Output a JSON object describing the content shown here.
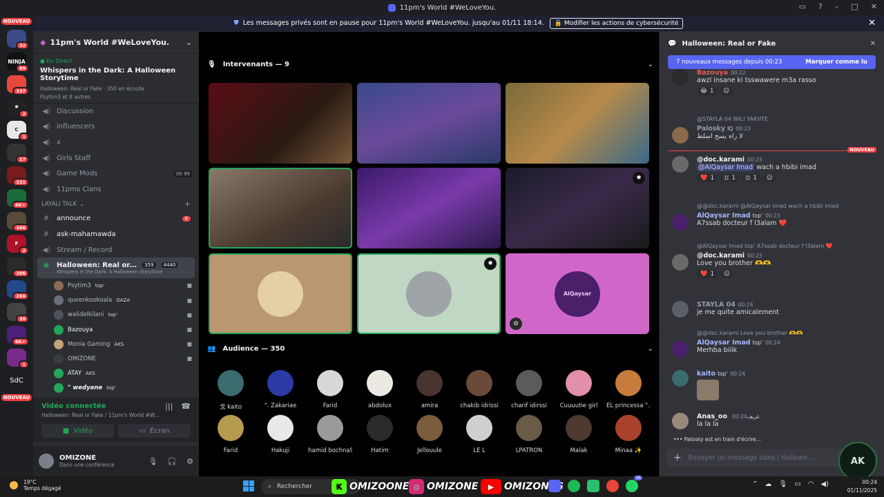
{
  "window": {
    "title": "11pm's World #WeLoveYou."
  },
  "banner": {
    "text": "Les messages privés sont en pause pour 11pm's World #WeLoveYou. jusqu'au 01/11 18:14.",
    "button": "Modifier les actions de cybersécurité"
  },
  "rail": {
    "top_label": "NOUVEAU",
    "bottom_label": "NOUVEAU",
    "sdc_label": "SdC",
    "badges": [
      "32",
      "69",
      "337",
      "2",
      "1",
      "17",
      "231",
      "4K+",
      "366",
      "2",
      "206",
      "266",
      "36",
      "6K+",
      "1"
    ]
  },
  "server": {
    "name": "11pm's World #WeLoveYou."
  },
  "live": {
    "label": "En Direct",
    "title": "Whispers in the Dark: A Halloween Storytime",
    "meta": "Halloween: Real or Fake · 350 en écoute",
    "users": "Psytim3 et 8 autres"
  },
  "channels": [
    {
      "name": "Discussion"
    },
    {
      "name": "influencers"
    },
    {
      "name": "x"
    },
    {
      "name": "Girls Staff"
    },
    {
      "name": "Game Mods",
      "count_a": "00",
      "count_b": "99"
    },
    {
      "name": "11pms Clans"
    }
  ],
  "category": {
    "name": "LAYALI TALK"
  },
  "text_channels": [
    {
      "name": "announce",
      "badge": "8"
    },
    {
      "name": "ask-mahamawda"
    },
    {
      "name": "Stream / Record"
    }
  ],
  "stage_channel": {
    "name": "Halloween: Real or...",
    "count": "359",
    "bitrate": "4440",
    "sub": "Whispers in the Dark: A Halloween Storytime"
  },
  "members": [
    {
      "name": "Psytim3",
      "tag": "top'"
    },
    {
      "name": "queenkookoala",
      "tag": "GAZA"
    },
    {
      "name": "walidelkilani",
      "tag": "top'"
    },
    {
      "name": "Bazouya",
      "tag": ""
    },
    {
      "name": "Monia Gaming",
      "tag": "AKS"
    },
    {
      "name": "OMIZONE",
      "tag": ""
    },
    {
      "name": "ATAY",
      "tag": "AKS"
    },
    {
      "name": "\" wedyane",
      "tag": "top'"
    }
  ],
  "voice": {
    "status": "Vidéo connectée",
    "sub": "Halloween: Real or Fake / 11pm's World #W...",
    "video_label": "Vidéo",
    "screen_label": "Écran"
  },
  "user": {
    "name": "OMIZONE",
    "status": "Dans une conférence"
  },
  "stage": {
    "speakers_header": "Intervenants — 9",
    "audience_header": "Audience — 350",
    "speaker_tag": "AlQaysar",
    "audience": [
      {
        "name": "戈 kaito",
        "color": "#3a6b6f"
      },
      {
        "name": "\". Zakariae",
        "color": "#2b3aa5"
      },
      {
        "name": "Farid",
        "color": "#d8d8d8"
      },
      {
        "name": "abdolux",
        "color": "#ece8e2"
      },
      {
        "name": "amira",
        "color": "#4a3430"
      },
      {
        "name": "chakib idrissi",
        "color": "#6b4a3a"
      },
      {
        "name": "charif idirssi",
        "color": "#5b5b5b"
      },
      {
        "name": "Cuuuutie girl",
        "color": "#e28fa9"
      },
      {
        "name": "EL princessa \"...",
        "color": "#c77b3c"
      },
      {
        "name": "Farid",
        "color": "#b69a4f"
      },
      {
        "name": "Hakuji",
        "color": "#e8e8e8"
      },
      {
        "name": "hamid bochna9",
        "color": "#9a9a9a"
      },
      {
        "name": "Hatim",
        "color": "#2a2a2a"
      },
      {
        "name": "Jellouule",
        "color": "#7a5c3e"
      },
      {
        "name": "LE L",
        "color": "#cfcfcf"
      },
      {
        "name": "LPATRON",
        "color": "#6a5a48"
      },
      {
        "name": "Malak",
        "color": "#4e3a30"
      },
      {
        "name": "Minaa ✨",
        "color": "#a9432c"
      }
    ]
  },
  "chat": {
    "title": "Halloween: Real or Fake",
    "new_messages": "7 nouveaux messages depuis 00:23",
    "mark_read": "Marquer comme lu",
    "new_label": "NOUVEAU",
    "messages": [
      {
        "user": "Bazouya",
        "time": "00:22",
        "text": "awzl insane ki tsswawere m3a rasso",
        "react1": "1"
      },
      {
        "reply": "@STAYLA 04 WILI YAKHTE",
        "user": "Palosky",
        "tag": "IQ",
        "time": "00:23",
        "text": "لا راه يسح اسلط"
      },
      {
        "user": "@doc.karami",
        "time": "00:23",
        "mention": "@AlQaysar Imad",
        "text": "wach a hbibi imad",
        "react1": "1",
        "react2": "1",
        "react3": "1"
      },
      {
        "reply": "@@doc.karami @AlQaysar Imad wach a hbibi imad",
        "user": "AlQaysar Imad",
        "tag": "top'",
        "time": "00:23",
        "text": "A7ssab docteur f l3alam ❤️"
      },
      {
        "reply": "@AlQaysar Imad top' A7ssab docteur f l3alam ❤️",
        "user": "@doc.karami",
        "time": "00:23",
        "text": "Love you brother 🫶🫶",
        "react1": "1"
      },
      {
        "user": "STAYLA 04",
        "time": "00:24",
        "text": "je me quite amicalement"
      },
      {
        "reply": "@@doc.karami Love you brother 🫶🫶",
        "user": "AlQaysar Imad",
        "tag": "top'",
        "time": "00:24",
        "text": "Merhba biiik"
      },
      {
        "user": "kaito",
        "tag": "top'",
        "time": "00:24",
        "text": ""
      },
      {
        "user": "Anas_oo",
        "tag": "غريف",
        "time": "00:24",
        "text": "la la la"
      }
    ],
    "typing": "Palosky est en train d'écrire...",
    "input_placeholder": "Envoyer un message dans  |  Hallowe...",
    "badge_text": "AK"
  },
  "taskbar": {
    "temp": "19°C",
    "weather": "Temps dégagé",
    "search_placeholder": "Rechercher",
    "social1": "OMIZOONE",
    "social2": "OMIZONE",
    "social3": "OMIZONEG",
    "time": "00:24",
    "date": "01/11/2025",
    "notif_count": "36"
  },
  "colors": {
    "accent": "#5865f2",
    "online": "#23a55a",
    "alert": "#f23f43"
  }
}
